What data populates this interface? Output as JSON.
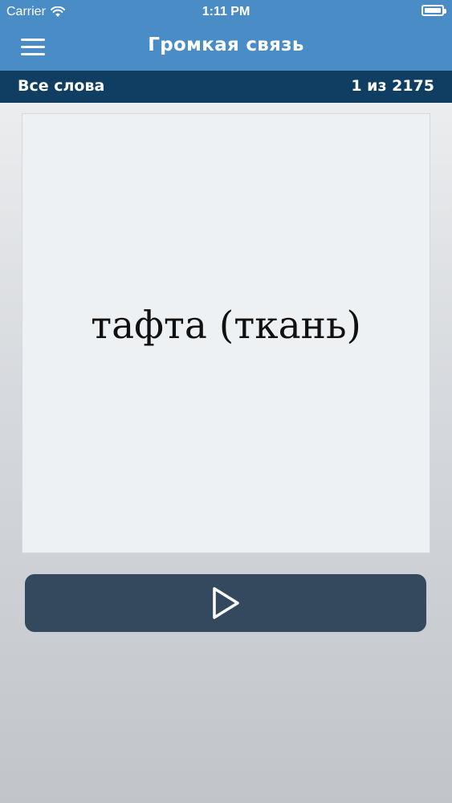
{
  "status_bar": {
    "carrier": "Carrier",
    "time": "1:11 PM",
    "wifi_icon": "wifi-icon",
    "battery_icon": "battery-icon"
  },
  "nav": {
    "title": "Громкая связь",
    "menu_icon": "hamburger-menu-icon"
  },
  "sub_bar": {
    "category": "Все слова",
    "counter": "1 из 2175"
  },
  "card": {
    "word": "тафта (ткань)"
  },
  "play": {
    "icon": "play-icon"
  },
  "colors": {
    "nav_blue": "#4a8cc5",
    "sub_bar_navy": "#0f3e62",
    "play_button": "#34495e",
    "card_bg": "#eef1f4"
  }
}
